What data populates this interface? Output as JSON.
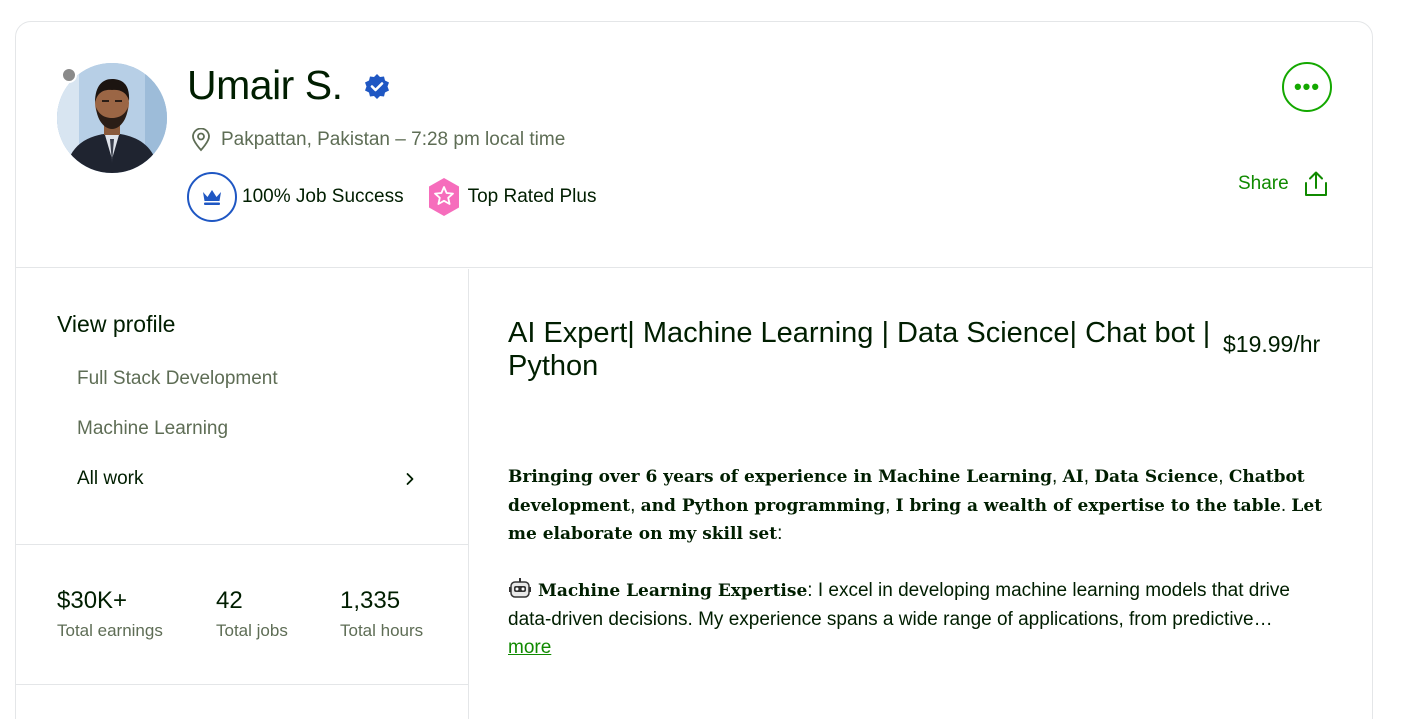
{
  "profile": {
    "name": "Umair S.",
    "location": "Pakpattan, Pakistan – 7:28 pm local time",
    "badges": {
      "job_success": "100% Job Success",
      "top_rated": "Top Rated Plus"
    },
    "share_label": "Share",
    "more_label": "•••"
  },
  "sidebar": {
    "view_profile": "View profile",
    "specialized_profiles": [
      "Full Stack Development",
      "Machine Learning"
    ],
    "all_work": "All work",
    "stats": [
      {
        "value": "$30K+",
        "label": "Total earnings"
      },
      {
        "value": "42",
        "label": "Total jobs"
      },
      {
        "value": "1,335",
        "label": "Total hours"
      }
    ]
  },
  "main": {
    "title": "AI Expert| Machine Learning | Data Science| Chat bot | Python",
    "rate": "$19.99/hr",
    "description": {
      "intro": {
        "p1": "Bringing over 6 years of experience in Machine Learning",
        "p2": "AI",
        "p3": "Data Science",
        "p4": "Chatbot development",
        "p5": "and Python programming",
        "p6": "I bring a wealth of expertise to the table",
        "p7": "Let me elaborate on my skill set"
      },
      "bullet_title": "Machine Learning Expertise",
      "bullet_text": "I excel in developing machine learning models that drive data-driven decisions. My experience spans a wide range of applications, from predictive…",
      "more": "more"
    }
  },
  "colors": {
    "brand_green": "#14a800",
    "link_green": "#108a00",
    "verified_blue": "#1f57c3",
    "top_rated_pink": "#f66dbc",
    "status_gray": "#8a8a8a"
  },
  "icons": [
    "location-pin-icon",
    "verified-badge-icon",
    "crown-icon",
    "star-badge-icon",
    "share-icon",
    "chevron-right-icon",
    "robot-icon",
    "more-dots-icon"
  ]
}
